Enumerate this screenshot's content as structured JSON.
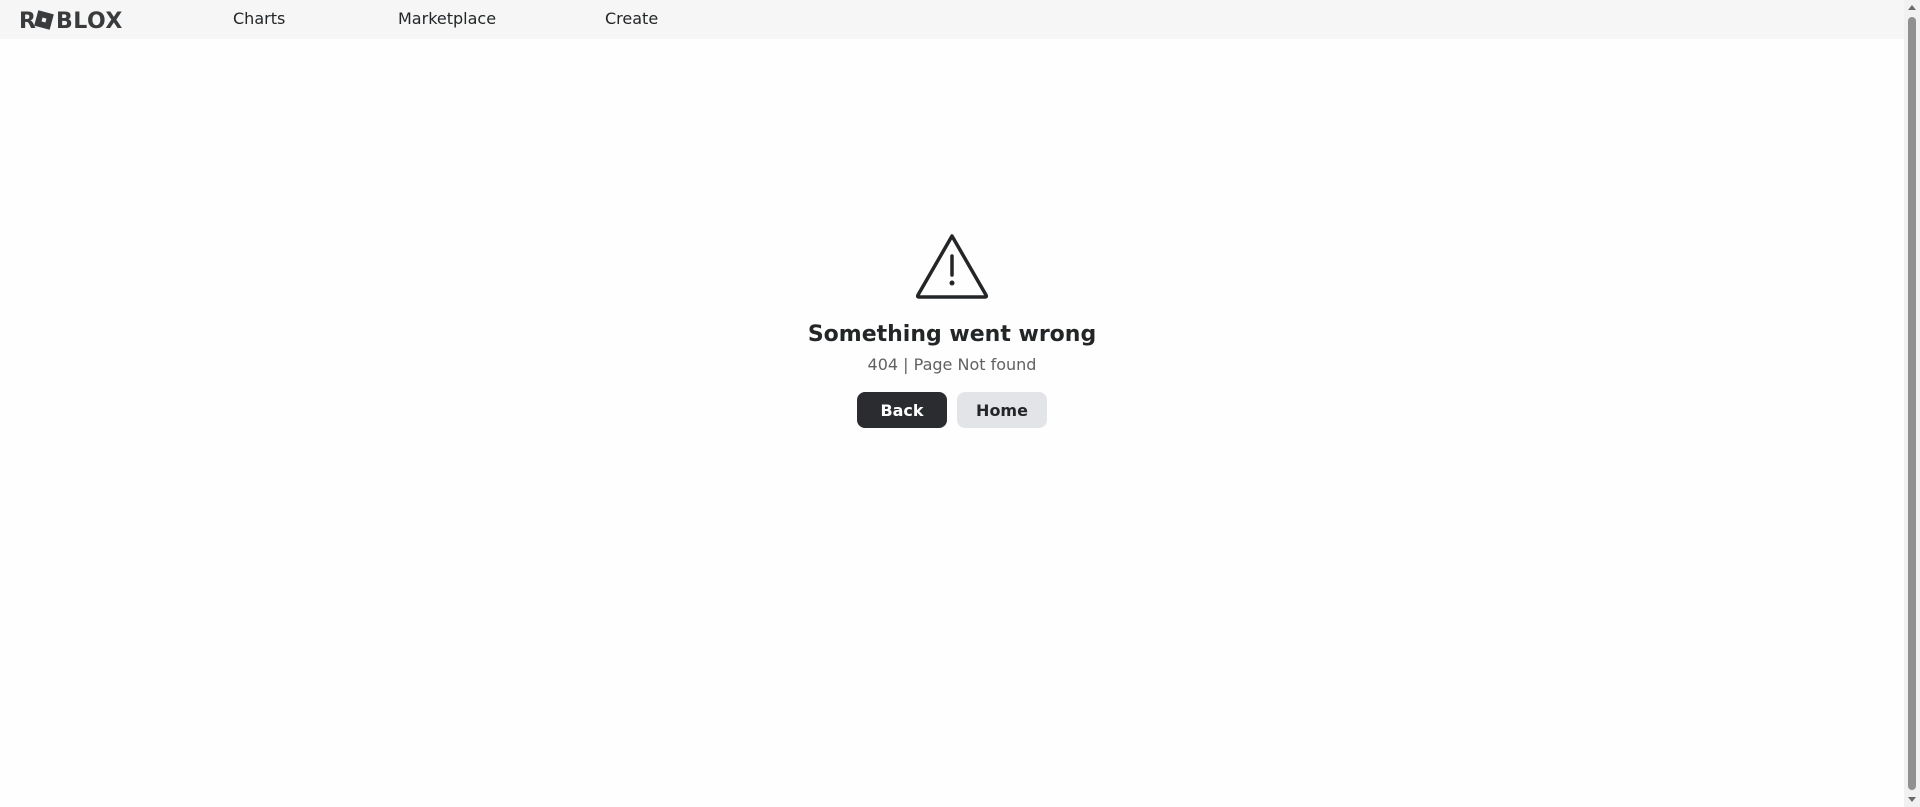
{
  "header": {
    "logo_text": "ROBLOX",
    "nav": [
      {
        "label": "Charts"
      },
      {
        "label": "Marketplace"
      },
      {
        "label": "Create"
      }
    ]
  },
  "error": {
    "icon": "warning-triangle-icon",
    "title": "Something went wrong",
    "subtitle": "404 | Page Not found",
    "back_label": "Back",
    "home_label": "Home"
  },
  "colors": {
    "header_bg": "#f6f6f6",
    "primary_button": "#2a2c30",
    "secondary_button": "#e3e4e8",
    "text": "#232527"
  }
}
